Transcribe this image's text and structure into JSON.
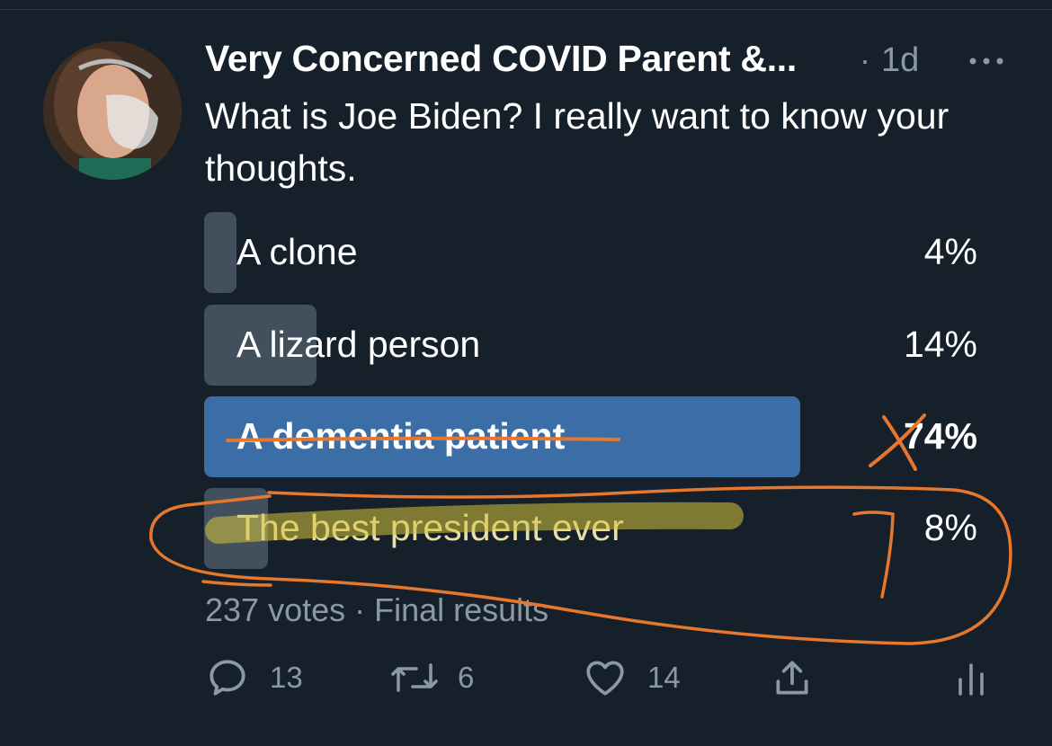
{
  "tweet": {
    "display_name": "Very Concerned COVID Parent &...",
    "time_separator": "·",
    "time": "1d",
    "text": "What is Joe Biden? I really want to know your thoughts."
  },
  "poll": {
    "options": [
      {
        "label": "A clone",
        "percent": "4%",
        "share": 4
      },
      {
        "label": "A lizard person",
        "percent": "14%",
        "share": 14
      },
      {
        "label": "A dementia patient",
        "percent": "74%",
        "share": 74,
        "winner": true
      },
      {
        "label": "The best president ever",
        "percent": "8%",
        "share": 8
      }
    ],
    "meta": "237 votes · Final results"
  },
  "actions": {
    "replies": "13",
    "retweets": "6",
    "likes": "14"
  },
  "colors": {
    "background": "#15202b",
    "bar": "#42505e",
    "winner_bar": "#3b6ea6",
    "muted_text": "#8b98a5",
    "annotation_orange": "#e8772e",
    "highlight_yellow": "#d6c43c"
  }
}
